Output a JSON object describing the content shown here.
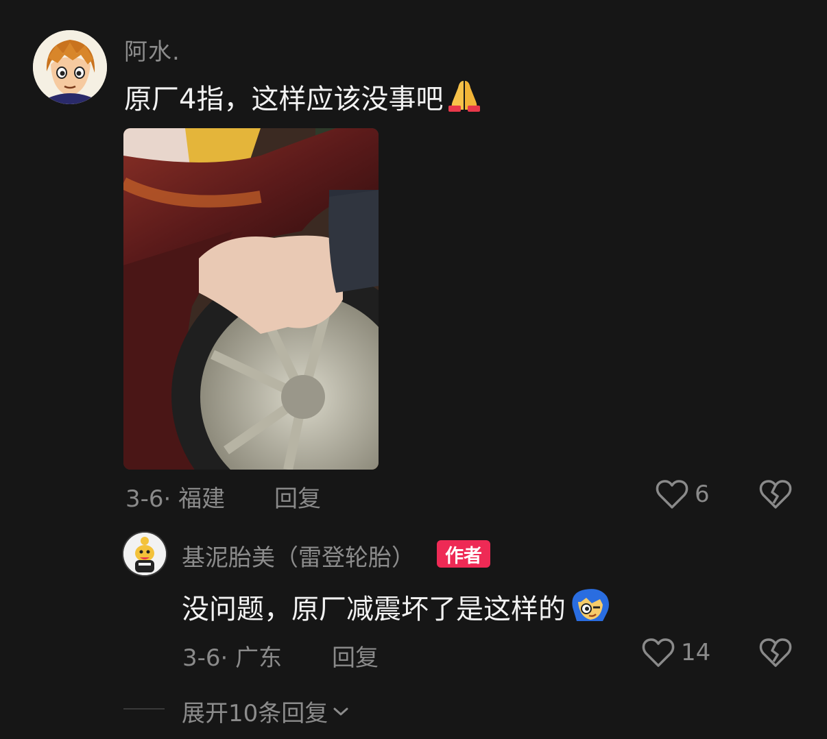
{
  "comment": {
    "username": "阿水.",
    "text": "原厂4指，这样应该没事吧",
    "emoji": "folded-hands",
    "date": "3-6",
    "separator": "·",
    "location": "福建",
    "reply_label": "回复",
    "likes": "6"
  },
  "reply": {
    "username": "基泥胎美（雷登轮胎）",
    "badge": "作者",
    "text": "没问题，原厂减震坏了是这样的",
    "emoji": "blue-hair-face",
    "date": "3-6",
    "separator": "·",
    "location": "广东",
    "reply_label": "回复",
    "likes": "14"
  },
  "expand": {
    "label": "展开10条回复"
  },
  "colors": {
    "background": "#161616",
    "badge": "#ee2a55",
    "muted_text": "#8a8a8a"
  }
}
